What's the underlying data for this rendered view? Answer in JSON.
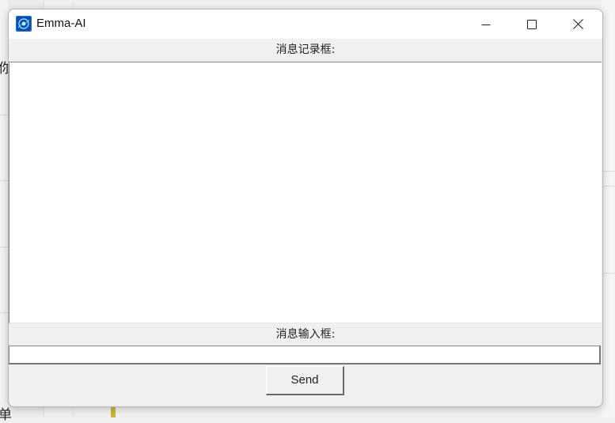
{
  "window": {
    "title": "Emma-AI",
    "app_icon": "emma-ai-app-icon",
    "controls": {
      "minimize_icon": "minimize-icon",
      "maximize_icon": "maximize-icon",
      "close_icon": "close-icon"
    }
  },
  "history": {
    "label": "消息记录框:",
    "messages": []
  },
  "input": {
    "label": "消息输入框:",
    "value": "",
    "placeholder": ""
  },
  "send": {
    "label": "Send"
  },
  "background": {
    "char_top": "你",
    "char_bottom": "单"
  },
  "colors": {
    "titlebar": "#ffffff",
    "window_bg": "#f0f0f0",
    "field_bg": "#ffffff",
    "icon_accent": "#1e6fd9"
  }
}
